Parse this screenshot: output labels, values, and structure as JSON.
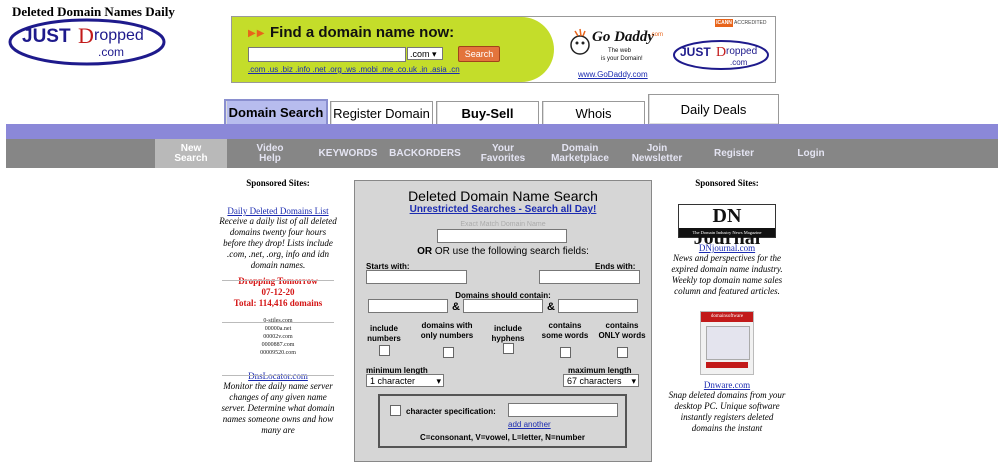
{
  "site": {
    "title": "Deleted Domain Names Daily",
    "logo_text": "JUST Dropped .com"
  },
  "banner": {
    "title": "Find a domain name now:",
    "tld_select": ".com",
    "search_button": "Search",
    "tlds": ".com .us .biz .info .net .org .ws .mobi .me .co.uk .in .asia .cn",
    "godaddy_tagline": "The web is your Domain!",
    "godaddy_link": "www.GoDaddy.com",
    "icann": "ICANN",
    "accredited": "ACCREDITED",
    "logo_text": "JUST Dropped .com"
  },
  "tabs": [
    "Domain Search",
    "Register Domain",
    "Buy-Sell",
    "Whois",
    "Daily Deals"
  ],
  "nav": [
    "New Search",
    "Video Help",
    "KEYWORDS",
    "BACKORDERS",
    "Your Favorites",
    "Domain Marketplace",
    "Join Newsletter",
    "Register",
    "Login"
  ],
  "left": {
    "heading": "Sponsored Sites:",
    "ad1_link": "Daily Deleted Domains List",
    "ad1_text": "Receive a daily list of all deleted domains twenty four hours before they drop! Lists include .com, .net, .org, info and idn domain names.",
    "dropping_title": "Dropping Tomorrow",
    "dropping_date": "07-12-20",
    "dropping_total": "Total: 114,416 domains",
    "sample_domains": [
      "0-stiles.com",
      "00000a.net",
      "00002v.com",
      "0000887.com",
      "00009520.com"
    ],
    "ad2_link": "DnsLocator.com",
    "ad2_text": "Monitor the daily name server changes of any given name server. Determine what domain names someone owns and how many are"
  },
  "form": {
    "title": "Deleted Domain Name Search",
    "subtitle": "Unrestricted Searches - Search all Day!",
    "exact_placeholder": "Exact Match Domain Name",
    "or_text": "OR use the following search fields:",
    "starts_with": "Starts with:",
    "ends_with": "Ends with:",
    "contains": "Domains should contain:",
    "amp": "&",
    "options": [
      "include numbers",
      "domains with only numbers",
      "include hyphens",
      "contains some words",
      "contains ONLY words"
    ],
    "min_length_label": "minimum length",
    "max_length_label": "maximum length",
    "min_length_value": "1 character",
    "max_length_value": "67 characters",
    "char_spec_label": "character specification:",
    "add_another": "add another",
    "legend": "C=consonant, V=vowel, L=letter, N=number"
  },
  "right": {
    "heading": "Sponsored Sites:",
    "dnjournal_logo": "DN Journal",
    "dnjournal_tagline": "The Domain Industry News Magazine",
    "ad1_link": "DNjournal.com",
    "ad1_text": "News and perspectives for the expired domain name industry. Weekly top domain name sales column and featured articles.",
    "dnware_box": "domainsoftware",
    "ad2_link": "Dnware.com",
    "ad2_text": "Snap deleted domains from your desktop PC. Unique software instantly registers deleted domains the instant"
  },
  "colors": {
    "accent": "#8b88d8",
    "nav_gray": "#868686",
    "link": "#1b2bb0",
    "red": "#d41414"
  }
}
